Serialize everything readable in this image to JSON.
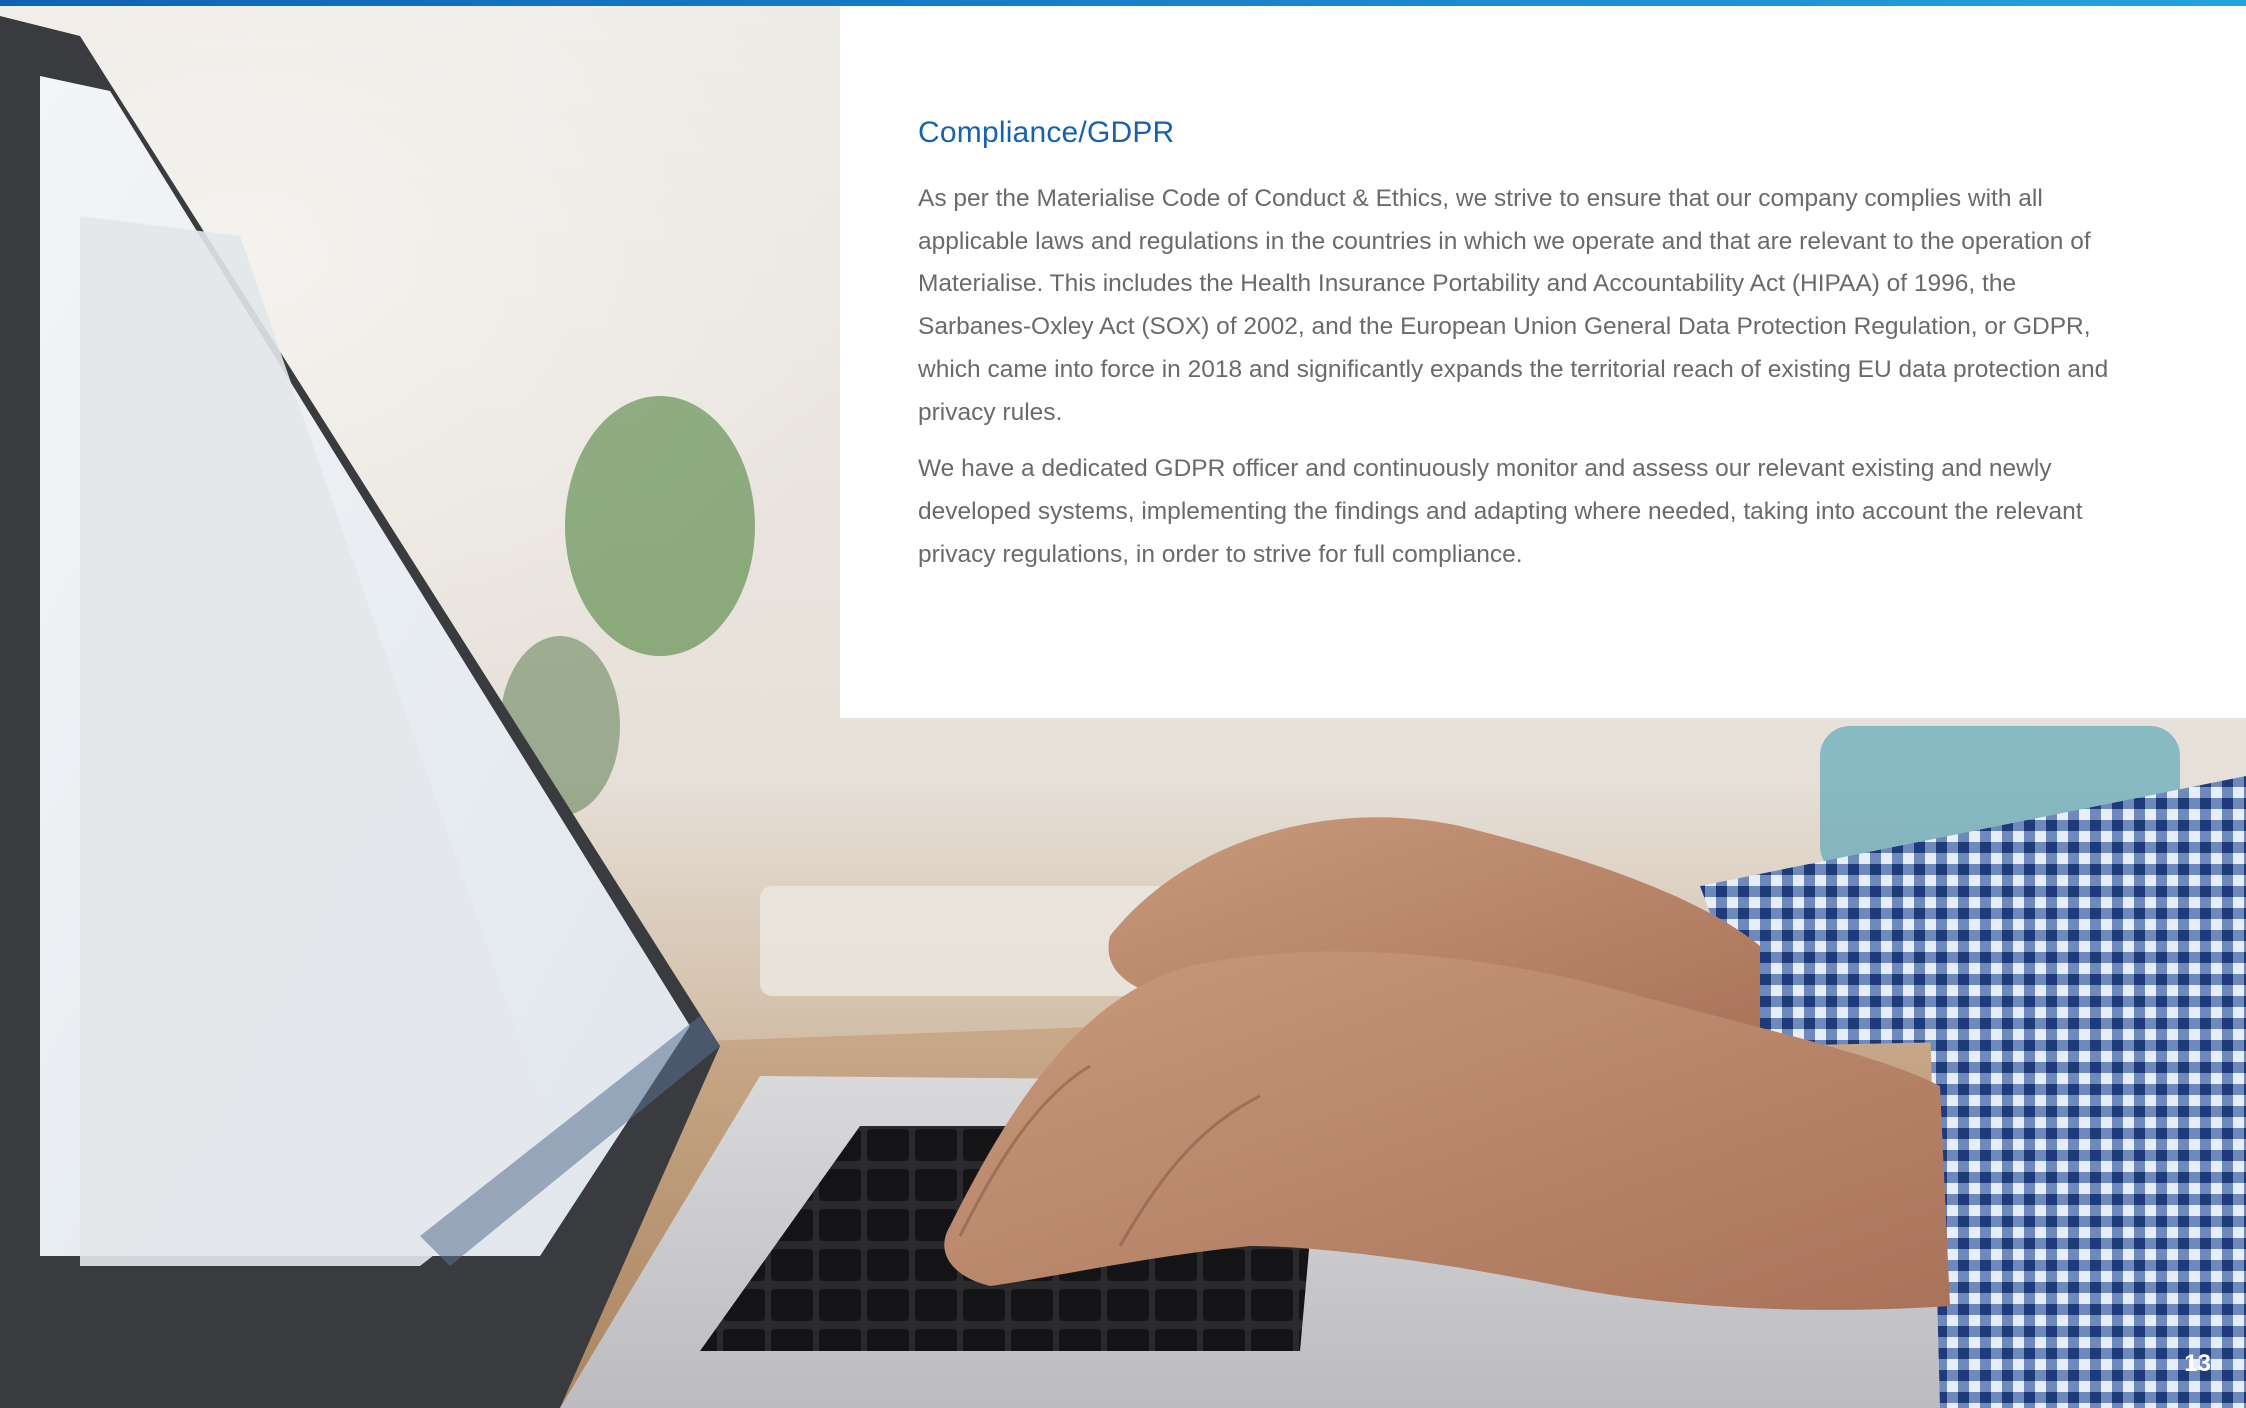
{
  "section": {
    "title": "Compliance/GDPR",
    "paragraphs": [
      "As per the Materialise Code of Conduct & Ethics, we strive to ensure that our company complies with all applicable laws and regulations in the countries in which we operate and that are relevant to the operation of Materialise. This includes the Health Insurance Portability and Accountability Act (HIPAA) of 1996, the Sarbanes-Oxley Act (SOX) of 2002, and the European Union General Data Protection Regulation, or GDPR, which came into force in 2018 and significantly expands the territorial reach of existing EU data protection and privacy rules.",
      "We have a dedicated GDPR officer and continuously monitor and assess our relevant existing and newly developed systems, implementing the findings and adapting where needed, taking into account the relevant privacy regulations, in order to strive for full compliance."
    ]
  },
  "page": {
    "number": "13"
  },
  "colors": {
    "heading": "#1761b0",
    "body_text": "#6a6a6a",
    "top_bar": "#1a86d0"
  },
  "image": {
    "description_icon": "laptop-typing-photo"
  }
}
